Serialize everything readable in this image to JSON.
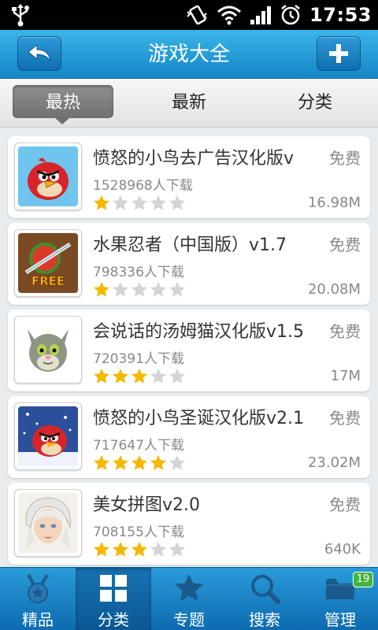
{
  "status_bar": {
    "time": "17:53",
    "icons": [
      "usb-icon",
      "vibrate-icon",
      "wifi-icon",
      "signal-icon",
      "alarm-icon"
    ]
  },
  "header": {
    "title": "游戏大全",
    "back_icon": "back-arrow-icon",
    "add_icon": "plus-icon"
  },
  "tabs": [
    {
      "label": "最热",
      "active": true
    },
    {
      "label": "最新",
      "active": false
    },
    {
      "label": "分类",
      "active": false
    }
  ],
  "apps": [
    {
      "name": "愤怒的小鸟去广告汉化版v",
      "price": "免费",
      "downloads": "1528968人下载",
      "rating": 1,
      "size": "16.98M",
      "icon": "angry-birds-icon"
    },
    {
      "name": "水果忍者（中国版）v1.7",
      "price": "免费",
      "downloads": "798336人下载",
      "rating": 1,
      "size": "20.08M",
      "icon": "fruit-ninja-icon"
    },
    {
      "name": "会说话的汤姆猫汉化版v1.5",
      "price": "免费",
      "downloads": "720391人下载",
      "rating": 3,
      "size": "17M",
      "icon": "talking-tom-icon"
    },
    {
      "name": "愤怒的小鸟圣诞汉化版v2.1",
      "price": "免费",
      "downloads": "717647人下载",
      "rating": 4,
      "size": "23.02M",
      "icon": "angry-birds-christmas-icon"
    },
    {
      "name": "美女拼图v2.0",
      "price": "免费",
      "downloads": "708155人下载",
      "rating": 3,
      "size": "640K",
      "icon": "beauty-puzzle-icon"
    }
  ],
  "bottom_nav": [
    {
      "label": "精品",
      "icon": "medal-icon",
      "active": false
    },
    {
      "label": "分类",
      "icon": "grid-icon",
      "active": true
    },
    {
      "label": "专题",
      "icon": "star-icon",
      "active": false
    },
    {
      "label": "搜索",
      "icon": "search-icon",
      "active": false
    },
    {
      "label": "管理",
      "icon": "folder-icon",
      "active": false,
      "badge": "19"
    }
  ],
  "colors": {
    "header_blue": "#1d92d3",
    "star_gold": "#f5b800",
    "star_empty": "#d4d4d4",
    "badge_green": "#43b43a"
  }
}
